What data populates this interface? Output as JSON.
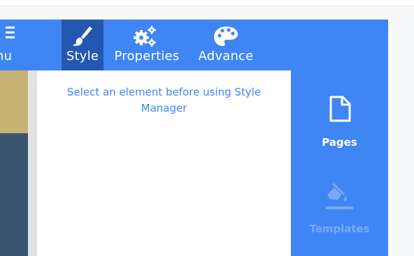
{
  "toolbar": {
    "tabs": [
      {
        "id": "menu",
        "label": "nu",
        "icon": "hamburger-icon"
      },
      {
        "id": "style",
        "label": "Style",
        "icon": "paintbrush-icon",
        "active": true
      },
      {
        "id": "properties",
        "label": "Properties",
        "icon": "gears-icon"
      },
      {
        "id": "advance",
        "label": "Advance",
        "icon": "palette-icon"
      }
    ]
  },
  "style_manager": {
    "message": "Select an element before using Style Manager"
  },
  "side_nav": {
    "items": [
      {
        "id": "pages",
        "label": "Pages",
        "icon": "page-icon"
      },
      {
        "id": "templates",
        "label": "Templates",
        "icon": "paint-bucket-icon"
      }
    ]
  },
  "colors": {
    "accent": "#3f86f4",
    "active_tab": "#2458b0",
    "canvas_gold": "#c6b374",
    "canvas_navy": "#3b5470",
    "muted_nav": "#79a9f6"
  }
}
